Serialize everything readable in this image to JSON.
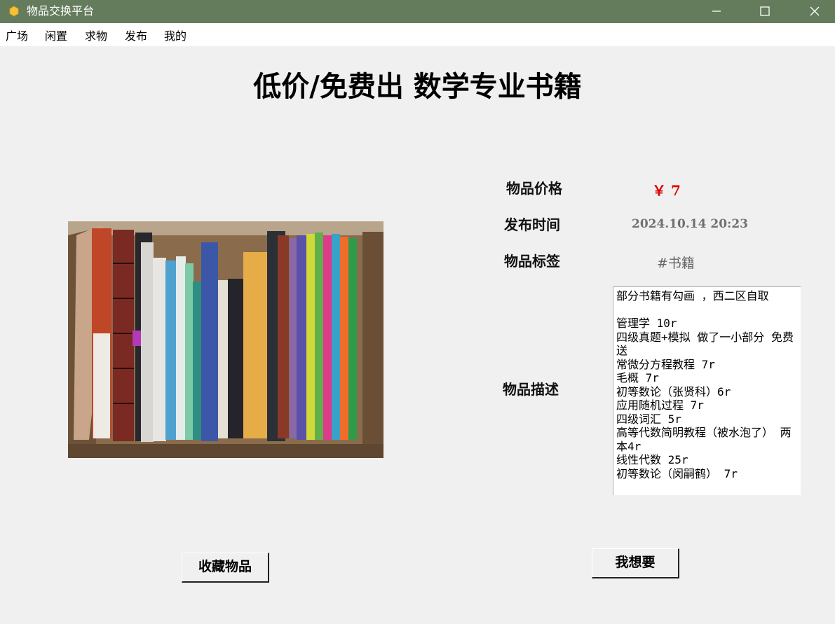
{
  "window": {
    "title": "物品交换平台",
    "icon": "hexagon-app-icon"
  },
  "menu": {
    "items": [
      "广场",
      "闲置",
      "求物",
      "发布",
      "我的"
    ]
  },
  "item": {
    "title": "低价/免费出 数学专业书籍",
    "price_label": "物品价格",
    "price": "￥ 7",
    "time_label": "发布时间",
    "time": "2024.10.14 20:23",
    "tag_label": "物品标签",
    "tag": "#书籍",
    "desc_label": "物品描述",
    "description": "部分书籍有勾画 ，西二区自取\n\n管理学 10r\n四级真题+模拟 做了一小部分 免费送\n常微分方程教程 7r\n毛概 7r\n初等数论（张贤科）6r\n应用随机过程 7r\n四级词汇 5r\n高等代数简明教程（被水泡了） 两本4r\n线性代数 25r\n初等数论（闵嗣鹤） 7r"
  },
  "buttons": {
    "favorite": "收藏物品",
    "want": "我想要"
  },
  "colors": {
    "titlebar": "#647c5c",
    "price": "#e00000",
    "background": "#f0f0f0"
  }
}
